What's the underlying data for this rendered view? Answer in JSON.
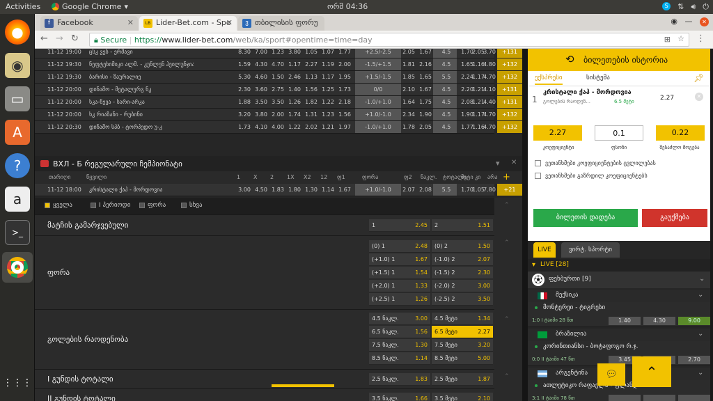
{
  "system": {
    "activities": "Activities",
    "app_name": "Google Chrome",
    "clock": "ორშ 04:36"
  },
  "browser": {
    "tabs": [
      {
        "label": "Facebook",
        "icon_color": "#3b5998",
        "icon_letter": "f"
      },
      {
        "label": "Lider-Bet.com - Spo",
        "icon_color": "#f2c200",
        "icon_letter": "LB"
      },
      {
        "label": "თბილისის ფორუ",
        "icon_color": "#2a6ab8",
        "icon_letter": "ვ"
      }
    ],
    "secure_label": "Secure",
    "url_scheme": "https://",
    "url_domain": "www.lider-bet.com",
    "url_path": "/web/ka/sport#opentime=time=day"
  },
  "matches": [
    {
      "time": "11-12 19:00",
      "name": "ცსკ ვეს - ერმავი",
      "odds": [
        "8.30",
        "7.00",
        "1.23",
        "3.80",
        "1.05",
        "1.07",
        "1.77"
      ],
      "handicap": "+2.5/-2.5",
      "h1": "2.05",
      "h2": "1.67",
      "total": "4.5",
      "o": "1.70",
      "u": "2.05",
      "x": "3.70",
      "plus": "+131"
    },
    {
      "time": "11-12 19:30",
      "name": "ნეფტეხიმიკი ალმ. - კუნლუნ ჰეილუნჯიანგ",
      "odds": [
        "1.59",
        "4.30",
        "4.70",
        "1.17",
        "2.27",
        "1.19",
        "2.00"
      ],
      "handicap": "-1.5/+1.5",
      "h1": "1.81",
      "h2": "2.16",
      "total": "4.5",
      "o": "1.65",
      "u": "1.16",
      "x": "4.80",
      "plus": "+132"
    },
    {
      "time": "11-12 19:30",
      "name": "ბარისი - ზაურალიე",
      "odds": [
        "5.30",
        "4.60",
        "1.50",
        "2.46",
        "1.13",
        "1.17",
        "1.95"
      ],
      "handicap": "+1.5/-1.5",
      "h1": "1.85",
      "h2": "1.65",
      "total": "5.5",
      "o": "2.24",
      "u": "1.17",
      "x": "4.70",
      "plus": "+132"
    },
    {
      "time": "11-12 20:00",
      "name": "დინამო - მეტალურგ ნკ",
      "odds": [
        "2.30",
        "3.60",
        "2.75",
        "1.40",
        "1.56",
        "1.25",
        "1.73"
      ],
      "handicap": "0/0",
      "h1": "2.10",
      "h2": "1.67",
      "total": "4.5",
      "o": "2.20",
      "u": "1.21",
      "x": "4.10",
      "plus": "+131"
    },
    {
      "time": "11-12 20:00",
      "name": "სკა-ნევა - სარი-არკა",
      "odds": [
        "1.88",
        "3.50",
        "3.50",
        "1.26",
        "1.82",
        "1.22",
        "2.18"
      ],
      "handicap": "-1.0/+1.0",
      "h1": "1.64",
      "h2": "1.75",
      "total": "4.5",
      "o": "2.08",
      "u": "1.21",
      "x": "4.40",
      "plus": "+131"
    },
    {
      "time": "11-12 20:00",
      "name": "ხკ რიაზანი - რუბინი",
      "odds": [
        "3.20",
        "3.80",
        "2.00",
        "1.74",
        "1.31",
        "1.23",
        "1.56"
      ],
      "handicap": "+1.0/-1.0",
      "h1": "2.34",
      "h2": "1.90",
      "total": "4.5",
      "o": "1.90",
      "u": "1.17",
      "x": "4.70",
      "plus": "+132"
    },
    {
      "time": "11-12 20:30",
      "name": "დინამო სპბ - ტორპედო უ-კ",
      "odds": [
        "1.73",
        "4.10",
        "4.00",
        "1.22",
        "2.02",
        "1.21",
        "1.97"
      ],
      "handicap": "-1.0/+1.0",
      "h1": "1.78",
      "h2": "2.05",
      "total": "4.5",
      "o": "1.77",
      "u": "1.16",
      "x": "4.70",
      "plus": "+132"
    }
  ],
  "league": {
    "title": "ВХЛ - Б რეგულარული ჩემპიონატი",
    "columns": [
      "თარიღი",
      "წყვილი",
      "1",
      "X",
      "2",
      "1X",
      "X2",
      "12",
      "ფ1",
      "ფორა",
      "ფ2",
      "ნაკლ.",
      "ტოტალი",
      "მეტი",
      "კი",
      "არა"
    ],
    "match": {
      "time": "11-12 18:00",
      "name": "კრისტალი ქაპ - მორდოვია",
      "odds": [
        "3.00",
        "4.50",
        "1.83",
        "1.80",
        "1.30",
        "1.14",
        "1.67"
      ],
      "handicap": "+1.0/-1.0",
      "h1": "2.07",
      "h2": "2.08",
      "total": "5.5",
      "o": "1.70",
      "u": "1.05",
      "x": "7.80",
      "plus": "+21"
    }
  },
  "market_tabs": [
    "ყველა",
    "I პერიოდი",
    "ფორა",
    "სხვა"
  ],
  "markets": {
    "result": {
      "name": "მატჩის გამარჯვებული",
      "c1": "1",
      "o1": "2.45",
      "c2": "2",
      "o2": "1.51"
    },
    "handicap": {
      "name": "ფორა",
      "rows": [
        {
          "l1": "(0) 1",
          "o1": "2.48",
          "l2": "(0) 2",
          "o2": "1.50"
        },
        {
          "l1": "(+1.0) 1",
          "o1": "1.67",
          "l2": "(-1.0) 2",
          "o2": "2.07"
        },
        {
          "l1": "(+1.5) 1",
          "o1": "1.54",
          "l2": "(-1.5) 2",
          "o2": "2.30"
        },
        {
          "l1": "(+2.0) 1",
          "o1": "1.33",
          "l2": "(-2.0) 2",
          "o2": "3.00"
        },
        {
          "l1": "(+2.5) 1",
          "o1": "1.26",
          "l2": "(-2.5) 2",
          "o2": "3.50"
        }
      ]
    },
    "totals": {
      "name": "გოლების რაოდენობა",
      "rows": [
        {
          "l1": "4.5 ნაკლ.",
          "o1": "3.00",
          "l2": "4.5 მეტი",
          "o2": "1.34"
        },
        {
          "l1": "6.5 ნაკლ.",
          "o1": "1.56",
          "l2": "6.5 მეტი",
          "o2": "2.27"
        },
        {
          "l1": "7.5 ნაკლ.",
          "o1": "1.30",
          "l2": "7.5 მეტი",
          "o2": "3.20"
        },
        {
          "l1": "8.5 ნაკლ.",
          "o1": "1.14",
          "l2": "8.5 მეტი",
          "o2": "5.00"
        }
      ]
    },
    "team1_total": {
      "name": "I გუნდის ტოტალი",
      "l1": "2.5 ნაკლ.",
      "o1": "1.83",
      "l2": "2.5 მეტი",
      "o2": "1.87"
    },
    "team2_total": {
      "name": "II გუნდის ტოტალი",
      "l1": "3.5 ნაკლ.",
      "o1": "1.66",
      "l2": "3.5 მეტი",
      "o2": "2.10"
    }
  },
  "betslip": {
    "history": "ბილეთების ისტორია",
    "tabs": [
      "ექსპრესი",
      "სისტემა"
    ],
    "item": {
      "index": "1",
      "match": "კრისტალი ქაპ - მორდოვია",
      "market": "გოლების რაოდენ...",
      "pick": "6.5 მეტი",
      "odd": "2.27"
    },
    "coef": "2.27",
    "stake": "0.1",
    "win": "0.22",
    "coef_label": "კოეფიციენტი",
    "stake_label": "ფსონი",
    "win_label": "შესაძლო მოგება",
    "chk1": "ვეთანხმები კოეფიციენტების ცვლილებას",
    "chk2": "ვეთანხმები გაზრდილ კოეფიციენტებს",
    "place": "ბილეთის დადება",
    "clear": "გაუქმება"
  },
  "live": {
    "tab_live": "LIVE",
    "tab_virtual": "ვირტ. სპორტი",
    "header": "LIVE [28]",
    "sport": "ფეხბურთი [9]",
    "events": [
      {
        "country": "მექსიკა",
        "teams": "მონტერეი - ტიგრესი",
        "score": "1:0 I ტაიმი 28 წთ",
        "o1": "1.40",
        "o2": "4.30",
        "o3": "9.00"
      },
      {
        "country": "ბრაზილია",
        "teams": "კორინთიანსი - ბოტაფოგო რ.ჯ.",
        "score": "0:0 II ტაიმი 47 წთ",
        "o1": "3.45",
        "o2": "2.45",
        "o3": "2.70"
      },
      {
        "country": "არგენტინა",
        "teams": "ათლეტიკო რაფაელა - ფლანდრია",
        "score": "3:1 II ტაიმი 78 წთ",
        "o1": "",
        "o2": "",
        "o3": ""
      }
    ]
  },
  "colors": {
    "accent": "#f2c200",
    "place_bet": "#2aa84a",
    "clear": "#d0342c"
  }
}
